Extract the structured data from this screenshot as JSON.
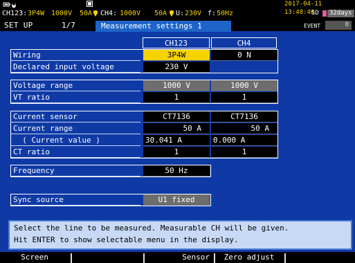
{
  "status_bar": {
    "row1": {
      "ch123": "CH123:",
      "wiring": "3P4W",
      "voltage": "1000V",
      "current": "50A",
      "ch4": "CH4:",
      "ch4_voltage": "1000V",
      "ch4_current": "50A",
      "u": "U:",
      "u_value": "230V",
      "f": "f:",
      "f_value": "50Hz",
      "datetime": "2017-04-11 13:48:40"
    },
    "sd_label": "SD",
    "sd_days": "32days"
  },
  "header": {
    "title": "SET UP",
    "page": "1/7",
    "tab": "Measurement settings 1",
    "event_label": "EVENT",
    "event_count": "0"
  },
  "table": {
    "columns": [
      "CH123",
      "CH4"
    ],
    "rows": {
      "wiring": {
        "label": "Wiring",
        "ch123": "3P4W",
        "ch4": "0 N"
      },
      "declared_voltage": {
        "label": "Declared input voltage",
        "ch123": "230 V"
      },
      "voltage_range": {
        "label": "Voltage range",
        "ch123": "1000 V",
        "ch4": "1000 V"
      },
      "vt_ratio": {
        "label": "VT ratio",
        "ch123": "1",
        "ch4": "1"
      },
      "current_sensor": {
        "label": "Current sensor",
        "ch123": "CT7136",
        "ch4": "CT7136"
      },
      "current_range": {
        "label": "Current range",
        "ch123": "50 A",
        "ch4": "50 A"
      },
      "current_value": {
        "label": "  ( Current value )",
        "ch123": "30.041 A",
        "ch4": "0.000 A"
      },
      "ct_ratio": {
        "label": "CT ratio",
        "ch123": "1",
        "ch4": "1"
      },
      "frequency": {
        "label": "Frequency",
        "ch123": "50 Hz"
      },
      "sync_source": {
        "label": "Sync source",
        "ch123": "U1 fixed"
      }
    }
  },
  "help": {
    "line1": "Select the line to be measured. Measurable CH will be given.",
    "line2": "Hit ENTER to show selectable menu in the display."
  },
  "function_keys": [
    "Screen",
    "",
    "Sensor",
    "Zero adjust",
    ""
  ],
  "colors": {
    "background": "#0f3aa6",
    "selected": "#f5d300",
    "readonly": "#6d6d6d",
    "tab": "#1e64c8",
    "help_bg": "#c8d9f5"
  }
}
